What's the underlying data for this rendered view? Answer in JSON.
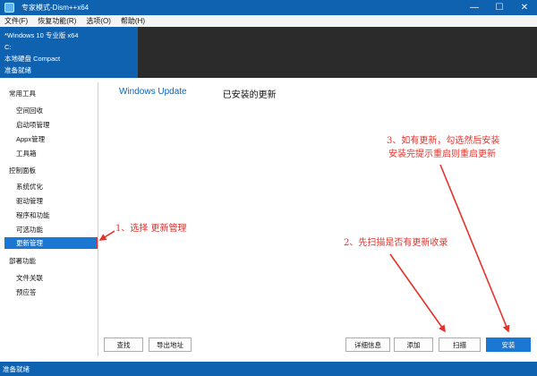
{
  "window": {
    "title": "专家模式-Dism++x64",
    "minimize_glyph": "—",
    "maximize_glyph": "☐",
    "close_glyph": "✕"
  },
  "menu": [
    "文件(F)",
    "恢复功能(R)",
    "选项(O)",
    "帮助(H)"
  ],
  "session": {
    "os": "*Windows 10 专业版 x64",
    "drive": "C:",
    "disk": "本地硬盘 Compact",
    "status": "准备就绪"
  },
  "sidebar": [
    {
      "category": "常用工具",
      "items": [
        "空间回收",
        "启动项管理",
        "Appx管理",
        "工具箱"
      ]
    },
    {
      "category": "控制面板",
      "items": [
        "系统优化",
        "驱动管理",
        "程序和功能",
        "可选功能",
        "更新管理"
      ]
    },
    {
      "category": "部署功能",
      "items": [
        "文件关联",
        "预应答"
      ]
    }
  ],
  "selected_item": "更新管理",
  "tabs": [
    "Windows Update",
    "已安装的更新"
  ],
  "buttons": {
    "find": "查找",
    "export": "导出地址",
    "details": "详细信息",
    "add": "添加",
    "scan": "扫描",
    "install": "安装"
  },
  "statusbar": "准备就绪",
  "annotations": {
    "step1": "1、选择 更新管理",
    "step2": "2、先扫描是否有更新收录",
    "step3_line1": "3、如有更新，勾选然后安装",
    "step3_line2": "安装完提示重启则重启更新"
  },
  "colors": {
    "accent": "#0e62b0",
    "button_primary": "#1a78d2",
    "annotation": "#e4322b",
    "session_bg": "#2b2b2b"
  },
  "icons": [
    "app-icon",
    "minimize-icon",
    "maximize-icon",
    "close-icon",
    "arrow-icon"
  ]
}
